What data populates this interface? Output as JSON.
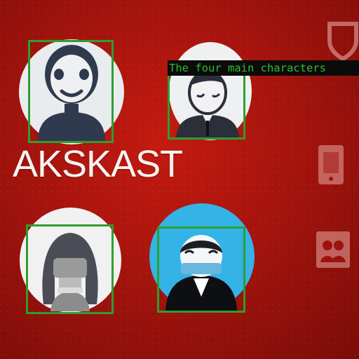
{
  "poster": {
    "brand_text": "AKSKAST",
    "background_color": "#a5140d",
    "avatars": [
      {
        "name": "bald-man-smiling",
        "circle_color": "#e9ecef"
      },
      {
        "name": "man-in-suit-sleeping",
        "circle_color": "#eef0f2"
      },
      {
        "name": "woman-with-long-hair-masked",
        "circle_color": "#f1f1f1"
      },
      {
        "name": "figure-with-blue-mask",
        "circle_color": "#34b3e7"
      }
    ],
    "side_icons": [
      "shield-icon",
      "phone-icon",
      "people-icon"
    ]
  },
  "annotation": {
    "caption": "The four main characters",
    "box_color": "#2e9e2e",
    "caption_text_color": "#2fbf2f",
    "caption_background": "#0b0b0b"
  }
}
